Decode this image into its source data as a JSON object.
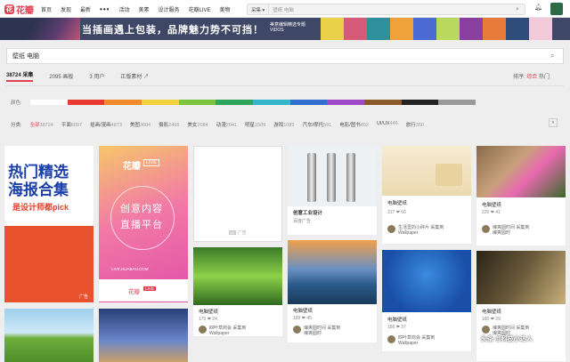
{
  "header": {
    "logo_mark": "花",
    "logo_text": "花瓣",
    "nav": [
      "首页",
      "发现",
      "最新",
      "•••",
      "活动",
      "美素",
      "设计服务",
      "花瓣LIVE",
      "美物"
    ],
    "search_scope": "采集 ▾",
    "search_value": "壁纸 电脑"
  },
  "banner": {
    "headline": "当插画遇上包装，品牌魅力势不可挡！",
    "sub1": "美意编辑精选专题",
    "sub2": "VIDOS",
    "tile_colors": [
      "#e9d24a",
      "#d85a7a",
      "#2f8f9a",
      "#f0a23a",
      "#4b6bd3",
      "#b8d95e",
      "#8b3fa0",
      "#e87a3a",
      "#2e4d7a",
      "#f3c8d8"
    ]
  },
  "search": {
    "value": "壁纸 电脑"
  },
  "tabs": [
    {
      "label": "38724 采集"
    },
    {
      "label": "2095 画板"
    },
    {
      "label": "3 用户"
    },
    {
      "label": "正版素材 ↗"
    }
  ],
  "sort": {
    "label": "排序:",
    "active": "综合",
    "other": "热门"
  },
  "colors": {
    "label": "颜色:",
    "swatches": [
      "#ffffff",
      "#e83a2f",
      "#f08a2c",
      "#f2d23a",
      "#7cc43b",
      "#2ea65a",
      "#35b5c9",
      "#2f6fd1",
      "#a04ac9",
      "#8b5a2b",
      "#222222",
      "#999999"
    ]
  },
  "categories": {
    "label": "分类:",
    "items": [
      {
        "name": "全部",
        "count": "38724"
      },
      {
        "name": "平面",
        "count": "6097"
      },
      {
        "name": "插画/漫画",
        "count": "4873"
      },
      {
        "name": "美图",
        "count": "3604"
      },
      {
        "name": "摄影",
        "count": "2466"
      },
      {
        "name": "美女",
        "count": "2084"
      },
      {
        "name": "动漫",
        "count": "2041"
      },
      {
        "name": "明星",
        "count": "1509"
      },
      {
        "name": "游戏",
        "count": "1089"
      },
      {
        "name": "汽车/摩托",
        "count": "591"
      },
      {
        "name": "电影/图书",
        "count": "492"
      },
      {
        "name": "UI/UX",
        "count": "446"
      },
      {
        "name": "旅行",
        "count": "350"
      }
    ],
    "more": "▾"
  },
  "pins": {
    "p1": {
      "big1": "热门精选",
      "big2": "海报合集",
      "pick": "是设计师都pick",
      "ad": "广告"
    },
    "p2": {
      "hb": "花瓣",
      "live": "LIVE",
      "line1": "创意内容",
      "line2": "直播平台",
      "url": "LIVE.HUABAN.COM"
    },
    "p3": {
      "ad": "广告",
      "chip": "AD"
    },
    "p4": {
      "caption": "电脑壁纸",
      "stats": "175 ❤ 24",
      "user": "四叶草商会 采集到",
      "board": "Wallpaper"
    },
    "p5": {
      "title": "创意工业设计",
      "sub": "百度广告"
    },
    "p6": {
      "caption": "电脑壁纸",
      "stats": "189 ❤ 45",
      "user": "壕爽圆时间 采集到",
      "board": "壕爽圆时"
    },
    "p7": {
      "caption": "电脑壁纸",
      "stats": "317 ❤ 66",
      "user": "生活里的小碎片 采集到",
      "board": "Wallpaper"
    },
    "p8": {
      "caption": "电脑壁纸",
      "stats": "186 ❤ 37",
      "user": "四叶草商会 采集到",
      "board": "Wallpaper"
    },
    "p9": {
      "caption": "电脑壁纸",
      "stats": "220 ❤ 41",
      "user": "壕爽圆时间 采集到",
      "board": "壕爽圆时"
    },
    "p10": {
      "caption": "电脑壁纸",
      "stats": "180 ❤ 29",
      "user": "壕爽圆时间 采集到",
      "board": "壕爽圆时"
    }
  },
  "watermark": "头条 @科技小达人"
}
